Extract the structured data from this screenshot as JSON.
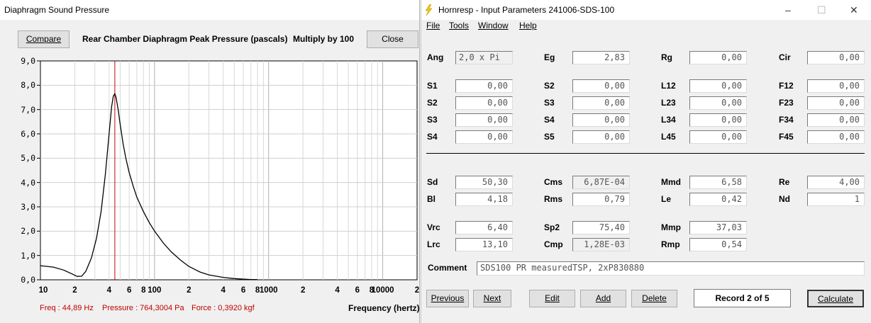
{
  "left_window": {
    "title": "Diaphragm Sound Pressure",
    "compare_label": "Compare",
    "chart_heading": "Rear Chamber Diaphragm Peak Pressure (pascals)",
    "multiply_label": "Multiply by 100",
    "close_label": "Close",
    "status": {
      "freq": "Freq : 44,89 Hz",
      "pressure": "Pressure : 764,3004 Pa",
      "force": "Force : 0,3920 kgf"
    },
    "xaxis_title": "Frequency (hertz)"
  },
  "chart_data": {
    "type": "line",
    "title": "Rear Chamber Diaphragm Peak Pressure (pascals)",
    "xlabel": "Frequency (hertz)",
    "ylabel": "",
    "xscale": "log",
    "xlim": [
      10,
      20000
    ],
    "ylim": [
      0,
      9
    ],
    "y_ticks": [
      "0,0",
      "1,0",
      "2,0",
      "3,0",
      "4,0",
      "5,0",
      "6,0",
      "7,0",
      "8,0",
      "9,0"
    ],
    "x_ticks": [
      "10",
      "2",
      "4",
      "6",
      "8",
      "100",
      "2",
      "4",
      "6",
      "8",
      "1000",
      "2",
      "4",
      "6",
      "8",
      "10000",
      "2"
    ],
    "x_tick_values": [
      10,
      20,
      40,
      60,
      80,
      100,
      200,
      400,
      600,
      800,
      1000,
      2000,
      4000,
      6000,
      8000,
      10000,
      20000
    ],
    "cursor_x": 44.89,
    "cursor_color": "#cc0000",
    "line_color": "#000000",
    "grid": true,
    "series": [
      {
        "x": [
          10,
          13,
          16,
          19,
          21,
          23,
          25,
          28,
          31,
          34,
          37,
          40,
          42,
          43.5,
          44.9,
          46,
          48,
          50,
          53,
          56,
          60,
          65,
          70,
          80,
          90,
          100,
          120,
          140,
          170,
          200,
          250,
          300,
          400,
          500,
          600,
          700,
          800
        ],
        "y": [
          0.58,
          0.52,
          0.4,
          0.24,
          0.14,
          0.15,
          0.35,
          0.9,
          1.7,
          2.8,
          4.3,
          6.0,
          7.1,
          7.55,
          7.65,
          7.5,
          7.0,
          6.4,
          5.6,
          5.0,
          4.4,
          3.85,
          3.4,
          2.8,
          2.35,
          2.0,
          1.5,
          1.15,
          0.8,
          0.55,
          0.32,
          0.2,
          0.1,
          0.05,
          0.03,
          0.01,
          0.01
        ]
      }
    ]
  },
  "right_window": {
    "title": "Hornresp - Input Parameters   241006-SDS-100",
    "menu": [
      "File",
      "Tools",
      "Window",
      "Help"
    ],
    "params": {
      "Ang": "2,0 x Pi",
      "Eg": "2,83",
      "Rg": "0,00",
      "Cir": "0,00",
      "S1": "0,00",
      "S2a": "0,00",
      "L12": "0,00",
      "F12": "0,00",
      "S2": "0,00",
      "S3a": "0,00",
      "L23": "0,00",
      "F23": "0,00",
      "S3": "0,00",
      "S4a": "0,00",
      "L34": "0,00",
      "F34": "0,00",
      "S4": "0,00",
      "S5": "0,00",
      "L45": "0,00",
      "F45": "0,00",
      "Sd": "50,30",
      "Cms": "6,87E-04",
      "Mmd": "6,58",
      "Re": "4,00",
      "Bl": "4,18",
      "Rms": "0,79",
      "Le": "0,42",
      "Nd": "1",
      "Vrc": "6,40",
      "Sp2": "75,40",
      "Mmp": "37,03",
      "Lrc": "13,10",
      "Cmp": "1,28E-03",
      "Rmp": "0,54"
    },
    "labels": {
      "Ang": "Ang",
      "Eg": "Eg",
      "Rg": "Rg",
      "Cir": "Cir",
      "S1": "S1",
      "S2a": "S2",
      "L12": "L12",
      "F12": "F12",
      "S2": "S2",
      "S3a": "S3",
      "L23": "L23",
      "F23": "F23",
      "S3": "S3",
      "S4a": "S4",
      "L34": "L34",
      "F34": "F34",
      "S4": "S4",
      "S5": "S5",
      "L45": "L45",
      "F45": "F45",
      "Sd": "Sd",
      "Cms": "Cms",
      "Mmd": "Mmd",
      "Re": "Re",
      "Bl": "Bl",
      "Rms": "Rms",
      "Le": "Le",
      "Nd": "Nd",
      "Vrc": "Vrc",
      "Sp2": "Sp2",
      "Mmp": "Mmp",
      "Lrc": "Lrc",
      "Cmp": "Cmp",
      "Rmp": "Rmp"
    },
    "comment_label": "Comment",
    "comment_value": "SDS100 PR measuredTSP, 2xP830880",
    "buttons": {
      "previous": "Previous",
      "next": "Next",
      "edit": "Edit",
      "add": "Add",
      "delete": "Delete",
      "calculate": "Calculate"
    },
    "record": "Record 2 of 5",
    "window_controls": {
      "minimize": "–",
      "maximize": "☐",
      "close": "✕"
    },
    "lightning_color": "#f2c500"
  }
}
